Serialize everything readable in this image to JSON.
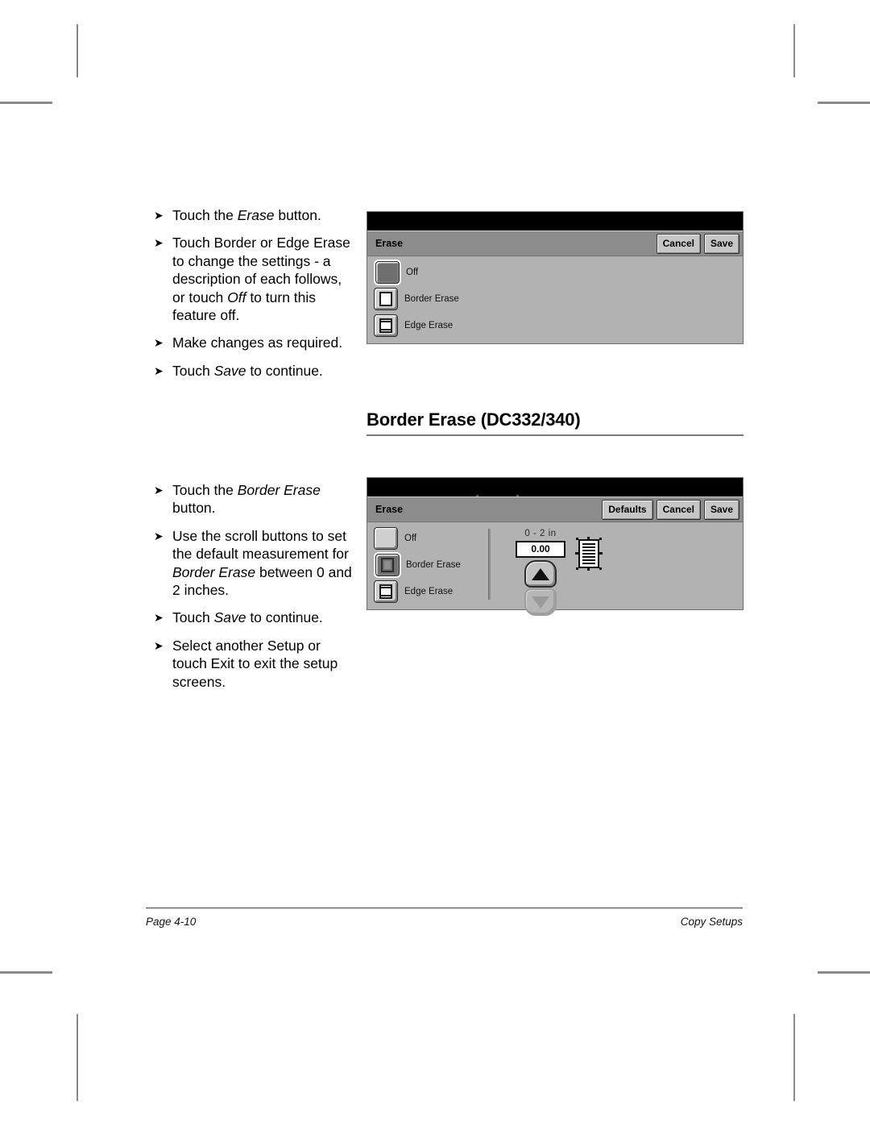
{
  "page": {
    "heading": "Border Erase (DC332/340)",
    "footer_left": "Page 4-10",
    "footer_right": "Copy Setups"
  },
  "bullet_marker": "➤",
  "instructions_top": [
    {
      "parts": [
        {
          "text": "Touch the ",
          "style": "normal"
        },
        {
          "text": "Erase",
          "style": "italic"
        },
        {
          "text": " button.",
          "style": "normal"
        }
      ]
    },
    {
      "parts": [
        {
          "text": "Touch Border or Edge Erase to change the settings - a description of each follows, or touch ",
          "style": "normal"
        },
        {
          "text": "Off",
          "style": "italic"
        },
        {
          "text": " to turn this feature off.",
          "style": "normal"
        }
      ]
    },
    {
      "parts": [
        {
          "text": "Make changes as required.",
          "style": "normal"
        }
      ]
    },
    {
      "parts": [
        {
          "text": "Touch ",
          "style": "normal"
        },
        {
          "text": "Save",
          "style": "italic"
        },
        {
          "text": " to continue.",
          "style": "normal"
        }
      ]
    }
  ],
  "instructions_bottom": [
    {
      "parts": [
        {
          "text": "Touch the ",
          "style": "normal"
        },
        {
          "text": "Border Erase",
          "style": "italic"
        },
        {
          "text": " button.",
          "style": "normal"
        }
      ]
    },
    {
      "parts": [
        {
          "text": "Use the scroll buttons to set the default measurement for ",
          "style": "normal"
        },
        {
          "text": "Border Erase",
          "style": "italic"
        },
        {
          "text": " between 0 and 2 inches.",
          "style": "normal"
        }
      ]
    },
    {
      "parts": [
        {
          "text": "Touch ",
          "style": "normal"
        },
        {
          "text": "Save",
          "style": "italic"
        },
        {
          "text": " to continue.",
          "style": "normal"
        }
      ]
    },
    {
      "parts": [
        {
          "text": "Select another Setup or touch Exit to exit the setup screens.",
          "style": "normal"
        }
      ]
    }
  ],
  "dialog_erase": {
    "title": "Erase",
    "buttons": [
      {
        "label": "Cancel",
        "name": "cancel-button"
      },
      {
        "label": "Save",
        "name": "save-button"
      }
    ],
    "options": [
      {
        "label": "Off",
        "selected": true,
        "icon": "solid-square-icon"
      },
      {
        "label": "Border Erase",
        "selected": false,
        "icon": "border-erase-page-icon"
      },
      {
        "label": "Edge Erase",
        "selected": false,
        "icon": "edge-erase-page-icon"
      }
    ]
  },
  "dialog_border_erase": {
    "title": "Erase",
    "buttons": [
      {
        "label": "Defaults",
        "name": "defaults-button"
      },
      {
        "label": "Cancel",
        "name": "cancel-button"
      },
      {
        "label": "Save",
        "name": "save-button"
      }
    ],
    "options": [
      {
        "label": "Off",
        "selected": false,
        "icon": "blank-square-icon"
      },
      {
        "label": "Border Erase",
        "selected": true,
        "icon": "border-erase-page-icon"
      },
      {
        "label": "Edge Erase",
        "selected": false,
        "icon": "edge-erase-page-icon"
      }
    ],
    "stepper": {
      "range_label": "0 - 2 in",
      "value": "0.00",
      "up_enabled": true,
      "down_enabled": false
    }
  },
  "colors": {
    "dialog_background": "#b2b2b2",
    "titlebar": "#8c8c8c",
    "blackbar": "#000000",
    "button_face": "#c6c6c6",
    "selected_outline": "#ffffff"
  }
}
